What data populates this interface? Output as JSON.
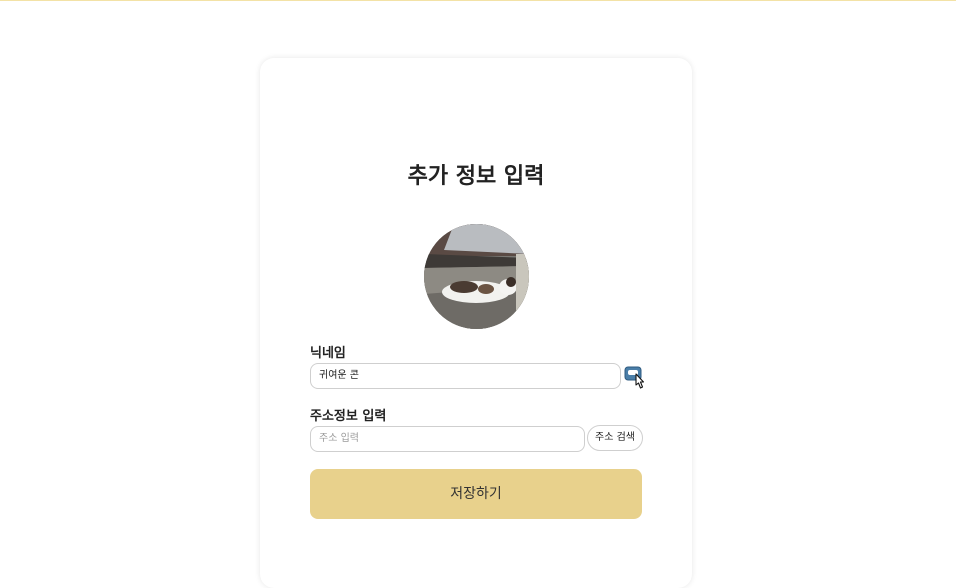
{
  "page": {
    "title": "추가 정보 입력"
  },
  "profile": {
    "avatar_alt": "cat photo"
  },
  "nickname": {
    "label": "닉네임",
    "value": "귀여운 콘",
    "check_icon": "confirm-cursor-icon"
  },
  "address": {
    "label": "주소정보 입력",
    "placeholder": "주소 입력",
    "search_label": "주소 검색"
  },
  "actions": {
    "save_label": "저장하기"
  },
  "colors": {
    "accent": "#e8d18c",
    "top_line": "#f3e2a6"
  }
}
